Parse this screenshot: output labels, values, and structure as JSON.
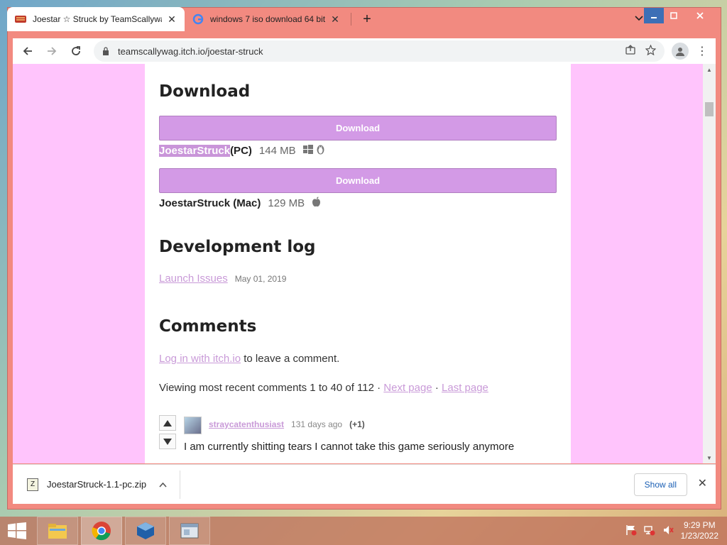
{
  "browser": {
    "tabs": [
      {
        "title": "Joestar ☆ Struck by TeamScallywag",
        "favicon": "itchio-game-favicon",
        "active": true
      },
      {
        "title": "windows 7 iso download 64 bit -",
        "favicon": "google-favicon",
        "active": false
      }
    ],
    "url": "teamscallywag.itch.io/joestar-struck"
  },
  "page": {
    "download_heading": "Download",
    "download_button_label": "Download",
    "files": [
      {
        "name": "JoestarStruck",
        "platform": "(PC)",
        "size": "144 MB",
        "os_icons": [
          "windows-icon",
          "linux-icon"
        ]
      },
      {
        "name": "JoestarStruck (Mac)",
        "platform": "",
        "size": "129 MB",
        "os_icons": [
          "apple-icon"
        ]
      }
    ],
    "devlog_heading": "Development log",
    "devlog_link": "Launch Issues",
    "devlog_date": "May 01, 2019",
    "comments_heading": "Comments",
    "login_link": "Log in with itch.io",
    "login_suffix": "to leave a comment.",
    "viewing_text": "Viewing most recent comments 1 to 40 of 112 ·",
    "next_page": "Next page",
    "sep": "·",
    "last_page": "Last page",
    "comment": {
      "user": "straycatenthusiast",
      "time": "131 days ago",
      "votes": "(+1)",
      "body": "I am currently shitting tears I cannot take this game seriously anymore"
    }
  },
  "shelf": {
    "file": "JoestarStruck-1.1-pc.zip",
    "show_all": "Show all"
  },
  "taskbar": {
    "time": "9:29 PM",
    "date": "1/23/2022"
  },
  "colors": {
    "accent": "#d39ae6",
    "page_bg": "#ffc4fc",
    "link": "#c99ad8"
  }
}
